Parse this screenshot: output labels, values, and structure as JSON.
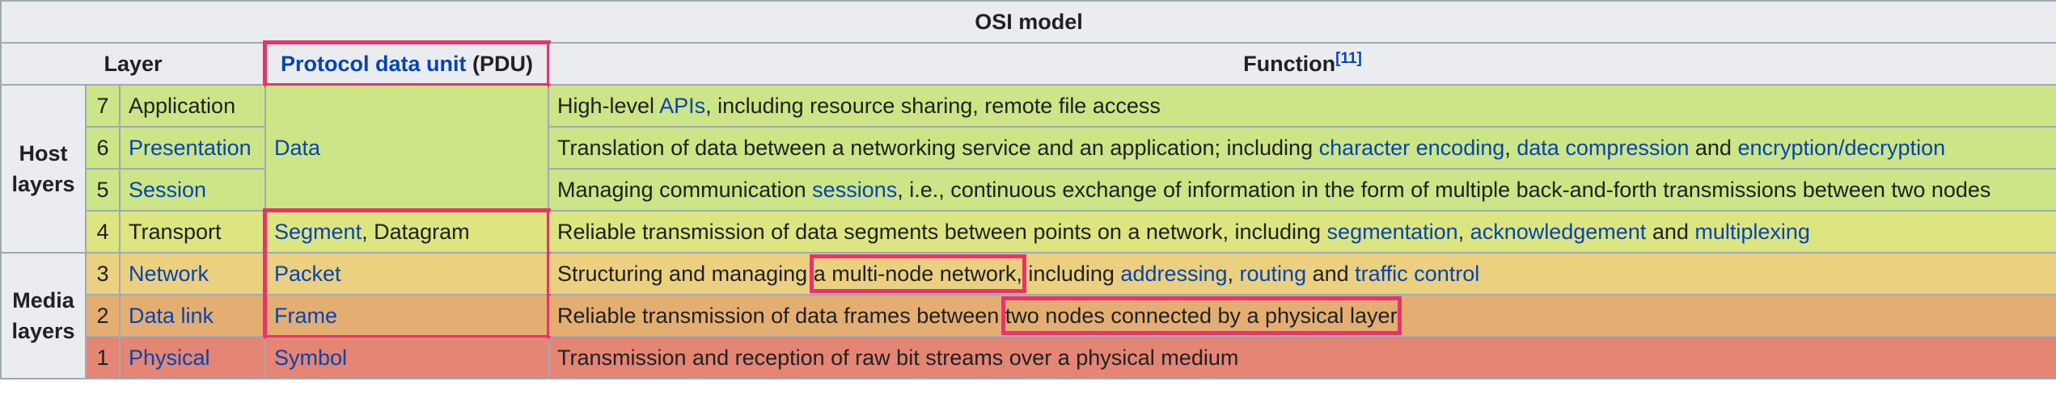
{
  "table": {
    "caption": "OSI model",
    "headers": {
      "layer": "Layer",
      "pdu_link": "Protocol data unit",
      "pdu_abbr": " (PDU)",
      "function": "Function",
      "function_ref": "[11]"
    },
    "groups": {
      "host": "Host layers",
      "media": "Media layers"
    },
    "rows": [
      {
        "num": "7",
        "name": "Application",
        "pdu": "Data",
        "func": [
          {
            "t": "High-level "
          },
          {
            "t": "APIs",
            "link": true
          },
          {
            "t": ", including resource sharing, remote file access"
          }
        ]
      },
      {
        "num": "6",
        "name": "Presentation",
        "func": [
          {
            "t": "Translation of data between a networking service and an application; including "
          },
          {
            "t": "character encoding",
            "link": true
          },
          {
            "t": ", "
          },
          {
            "t": "data compression",
            "link": true
          },
          {
            "t": " and "
          },
          {
            "t": "encryption/decryption",
            "link": true
          }
        ]
      },
      {
        "num": "5",
        "name": "Session",
        "func": [
          {
            "t": "Managing communication "
          },
          {
            "t": "sessions",
            "link": true
          },
          {
            "t": ", i.e., continuous exchange of information in the form of multiple back-and-forth transmissions between two nodes"
          }
        ]
      },
      {
        "num": "4",
        "name": "Transport",
        "pdu_parts": [
          {
            "t": "Segment",
            "link": true
          },
          {
            "t": ", "
          },
          {
            "t": "Datagram"
          }
        ],
        "func": [
          {
            "t": "Reliable transmission of data segments between points on a network, including "
          },
          {
            "t": "segmentation",
            "link": true
          },
          {
            "t": ", "
          },
          {
            "t": "acknowledgement",
            "link": true
          },
          {
            "t": " and "
          },
          {
            "t": "multiplexing",
            "link": true
          }
        ]
      },
      {
        "num": "3",
        "name": "Network",
        "pdu": "Packet",
        "func": [
          {
            "t": "Structuring and managing "
          },
          {
            "t": "a multi-node network,",
            "hl": true
          },
          {
            "t": " including "
          },
          {
            "t": "addressing",
            "link": true
          },
          {
            "t": ", "
          },
          {
            "t": "routing",
            "link": true
          },
          {
            "t": " and "
          },
          {
            "t": "traffic control",
            "link": true
          }
        ]
      },
      {
        "num": "2",
        "name": "Data link",
        "pdu": "Frame",
        "func": [
          {
            "t": "Reliable transmission of data frames between "
          },
          {
            "t": "two nodes connected by a physical layer",
            "hl": true
          }
        ]
      },
      {
        "num": "1",
        "name": "Physical",
        "pdu": "Symbol",
        "func": [
          {
            "t": "Transmission and reception of raw bit streams over a physical medium"
          }
        ]
      }
    ],
    "colors": {
      "host_layers": "#cce586",
      "transport": "#dde580",
      "network": "#ebd080",
      "data_link": "#e4ae72",
      "physical": "#e58574",
      "header_bg": "#eaecf0",
      "border": "#a2a9b1",
      "link": "#0645ad",
      "highlight_box": "#e8336b"
    }
  }
}
